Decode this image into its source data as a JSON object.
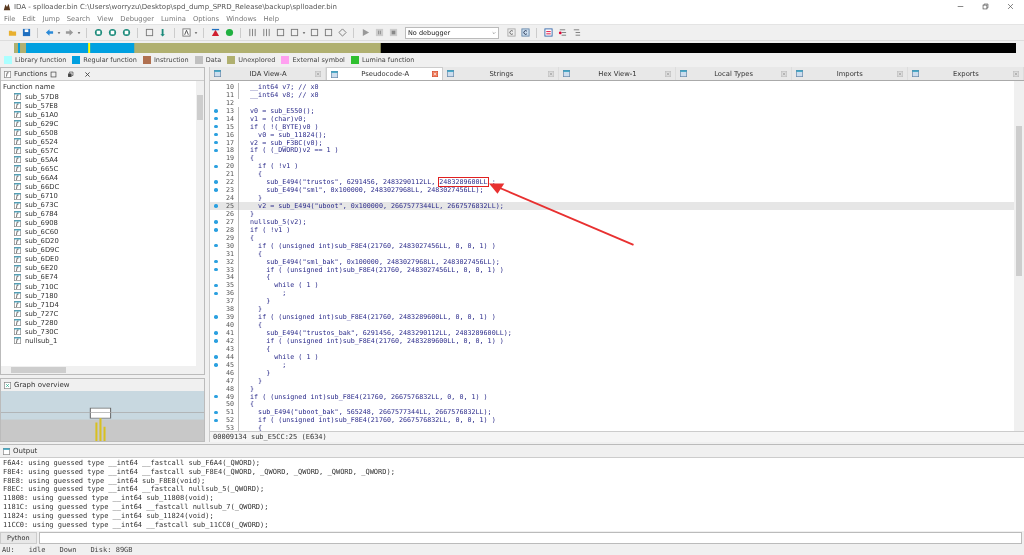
{
  "window": {
    "title": "IDA - splloader.bin C:\\Users\\worryzu\\Desktop\\spd_dump_SPRD_Release\\backup\\splloader.bin"
  },
  "menu": [
    "File",
    "Edit",
    "Jump",
    "Search",
    "View",
    "Debugger",
    "Lumina",
    "Options",
    "Windows",
    "Help"
  ],
  "toolbar": {
    "debugger_select": "No debugger"
  },
  "legend": [
    {
      "label": "Library function",
      "color": "#aaffff"
    },
    {
      "label": "Regular function",
      "color": "#00a0e0"
    },
    {
      "label": "Instruction",
      "color": "#b07050"
    },
    {
      "label": "Data",
      "color": "#c0c0c0"
    },
    {
      "label": "Unexplored",
      "color": "#b0b070"
    },
    {
      "label": "External symbol",
      "color": "#ffa0f0"
    },
    {
      "label": "Lumina function",
      "color": "#30c030"
    }
  ],
  "functions": {
    "title": "Functions",
    "column": "Function name",
    "items": [
      "sub_57D8",
      "sub_57E8",
      "sub_61A0",
      "sub_629C",
      "sub_6508",
      "sub_6524",
      "sub_657C",
      "sub_65A4",
      "sub_665C",
      "sub_66A4",
      "sub_66DC",
      "sub_6710",
      "sub_673C",
      "sub_6784",
      "sub_6908",
      "sub_6C60",
      "sub_6D20",
      "sub_6D9C",
      "sub_6DE0",
      "sub_6E20",
      "sub_6E74",
      "sub_710C",
      "sub_7180",
      "sub_71D4",
      "sub_727C",
      "sub_7280",
      "sub_730C",
      "nullsub_1"
    ]
  },
  "graph_overview": {
    "title": "Graph overview"
  },
  "tabs": [
    {
      "label": "IDA View-A",
      "selected": false
    },
    {
      "label": "Pseudocode-A",
      "selected": true
    },
    {
      "label": "Strings",
      "selected": false
    },
    {
      "label": "Hex View-1",
      "selected": false
    },
    {
      "label": "Local Types",
      "selected": false
    },
    {
      "label": "Imports",
      "selected": false
    },
    {
      "label": "Exports",
      "selected": false
    }
  ],
  "code": [
    {
      "num": "10",
      "dot": false,
      "text": "  __int64 v7; // x0"
    },
    {
      "num": "11",
      "dot": false,
      "text": "  __int64 v8; // x0"
    },
    {
      "num": "12",
      "dot": false
    },
    {
      "num": "13",
      "dot": true,
      "text": "  v0 = sub_E550();"
    },
    {
      "num": "14",
      "dot": true,
      "text": "  v1 = (char)v0;"
    },
    {
      "num": "15",
      "dot": true,
      "text": "  if ( !(_BYTE)v0 )"
    },
    {
      "num": "16",
      "dot": true,
      "text": "    v0 = sub_11824();"
    },
    {
      "num": "17",
      "dot": true,
      "text": "  v2 = sub_F3BC(v0);"
    },
    {
      "num": "18",
      "dot": true,
      "text": "  if ( (_DWORD)v2 == 1 )"
    },
    {
      "num": "19",
      "dot": false,
      "text": "  {"
    },
    {
      "num": "20",
      "dot": true,
      "text": "    if ( !v1 )"
    },
    {
      "num": "21",
      "dot": false,
      "text": "    {"
    },
    {
      "num": "22",
      "dot": true,
      "text": "      sub_E494(\"trustos\", 6291456, 2483290112LL, ",
      "boxed": "2483289600LL",
      "after": " ;"
    },
    {
      "num": "23",
      "dot": true,
      "text": "      sub_E494(\"sml\", 0x100000, 2483027968LL, 2483027456LL);"
    },
    {
      "num": "24",
      "dot": false,
      "text": "    }"
    },
    {
      "num": "25",
      "dot": true,
      "text": "    v2 = sub_E494(\"uboot\", 0x100000, 2667577344LL, 2667576832LL);",
      "highlighted": true
    },
    {
      "num": "26",
      "dot": false,
      "text": "  }"
    },
    {
      "num": "27",
      "dot": true,
      "text": "  nullsub_5(v2);"
    },
    {
      "num": "28",
      "dot": true,
      "text": "  if ( !v1 )"
    },
    {
      "num": "29",
      "dot": false,
      "text": "  {"
    },
    {
      "num": "30",
      "dot": true,
      "text": "    if ( (unsigned int)sub_F8E4(21760, 2483027456LL, 0, 0, 1) )"
    },
    {
      "num": "31",
      "dot": false,
      "text": "    {"
    },
    {
      "num": "32",
      "dot": true,
      "text": "      sub_E494(\"sml_bak\", 0x100000, 2483027968LL, 2483027456LL);"
    },
    {
      "num": "33",
      "dot": true,
      "text": "      if ( (unsigned int)sub_F8E4(21760, 2483027456LL, 0, 0, 1) )"
    },
    {
      "num": "34",
      "dot": false,
      "text": "      {"
    },
    {
      "num": "35",
      "dot": true,
      "text": "        while ( 1 )"
    },
    {
      "num": "36",
      "dot": true,
      "text": "          ;"
    },
    {
      "num": "37",
      "dot": false,
      "text": "      }"
    },
    {
      "num": "38",
      "dot": false,
      "text": "    }"
    },
    {
      "num": "39",
      "dot": true,
      "text": "    if ( (unsigned int)sub_F8E4(21760, 2483289600LL, 0, 0, 1) )"
    },
    {
      "num": "40",
      "dot": false,
      "text": "    {"
    },
    {
      "num": "41",
      "dot": true,
      "text": "      sub_E494(\"trustos_bak\", 6291456, 2483290112LL, 2483289600LL);"
    },
    {
      "num": "42",
      "dot": true,
      "text": "      if ( (unsigned int)sub_F8E4(21760, 2483289600LL, 0, 0, 1) )"
    },
    {
      "num": "43",
      "dot": false,
      "text": "      {"
    },
    {
      "num": "44",
      "dot": true,
      "text": "        while ( 1 )"
    },
    {
      "num": "45",
      "dot": true,
      "text": "          ;"
    },
    {
      "num": "46",
      "dot": false,
      "text": "      }"
    },
    {
      "num": "47",
      "dot": false,
      "text": "    }"
    },
    {
      "num": "48",
      "dot": false,
      "text": "  }"
    },
    {
      "num": "49",
      "dot": true,
      "text": "  if ( (unsigned int)sub_F8E4(21760, 2667576832LL, 0, 0, 1) )"
    },
    {
      "num": "50",
      "dot": false,
      "text": "  {"
    },
    {
      "num": "51",
      "dot": true,
      "text": "    sub_E494(\"uboot_bak\", 565248, 2667577344LL, 2667576832LL);"
    },
    {
      "num": "52",
      "dot": true,
      "text": "    if ( (unsigned int)sub_F8E4(21760, 2667576832LL, 0, 0, 1) )"
    },
    {
      "num": "53",
      "dot": false,
      "text": "    {"
    }
  ],
  "code_status": "00009134 sub_E5CC:25 (E634)",
  "output": {
    "title": "Output",
    "lines": [
      "F6A4: using guessed type __int64 __fastcall sub_F6A4(_QWORD);",
      "F8E4: using guessed type __int64 __fastcall sub_F8E4(_QWORD, _QWORD, _QWORD, _QWORD, _QWORD);",
      "F8E8: using guessed type __int64 sub_F8E8(void);",
      "F8EC: using guessed type __int64 __fastcall nullsub_5(_QWORD);",
      "11808: using guessed type __int64 sub_11808(void);",
      "1181C: using guessed type __int64 __fastcall nullsub_7(_QWORD);",
      "11824: using guessed type __int64 sub_11824(void);",
      "11CC0: using guessed type __int64 __fastcall sub_11CC0(_QWORD);"
    ]
  },
  "python_button": "Python",
  "status_bar": [
    "AU:",
    "idle",
    "Down",
    "Disk: 89GB"
  ]
}
